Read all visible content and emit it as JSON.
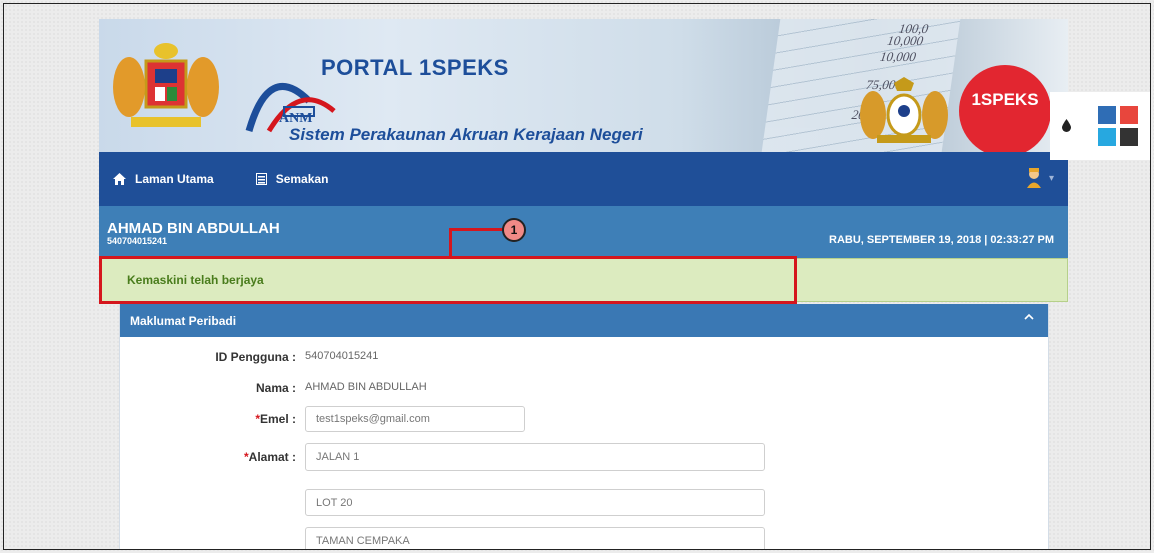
{
  "header": {
    "title": "PORTAL 1SPEKS",
    "subtitle": "Sistem Perakaunan Akruan Kerajaan Negeri",
    "logo_text": "ANM",
    "badge_text": "1SPEKS",
    "ledger_numbers": [
      "100,0",
      "10,000",
      "10,000",
      "75,000",
      "205"
    ]
  },
  "nav": {
    "items": [
      {
        "label": "Laman Utama",
        "icon": "home-icon"
      },
      {
        "label": "Semakan",
        "icon": "list-icon"
      }
    ],
    "user_icon": "user-avatar-icon"
  },
  "user": {
    "name": "AHMAD BIN ABDULLAH",
    "id": "540704015241",
    "datetime": "RABU, SEPTEMBER 19, 2018 | 02:33:27 PM"
  },
  "alert": {
    "message": "Kemaskini telah berjaya"
  },
  "callout": {
    "number": "1"
  },
  "panel": {
    "title": "Maklumat Peribadi",
    "fields": {
      "id_label": "ID Pengguna :",
      "id_value": "540704015241",
      "name_label": "Nama :",
      "name_value": "AHMAD BIN ABDULLAH",
      "email_label": "Emel :",
      "email_value": "test1speks@gmail.com",
      "address_label": "Alamat :",
      "address_line1": "JALAN 1",
      "address_line2": "LOT 20",
      "address_line3": "TAMAN CEMPAKA",
      "required_mark": "*"
    }
  },
  "theme": {
    "swatches": [
      "#2f6db5",
      "#e8463d",
      "#27a8e0",
      "#333333"
    ]
  },
  "colors": {
    "nav_bg": "#1f4f98",
    "user_bar_bg": "#3e7fb7",
    "alert_bg": "#dcebbf",
    "callout": "#d5161d"
  }
}
